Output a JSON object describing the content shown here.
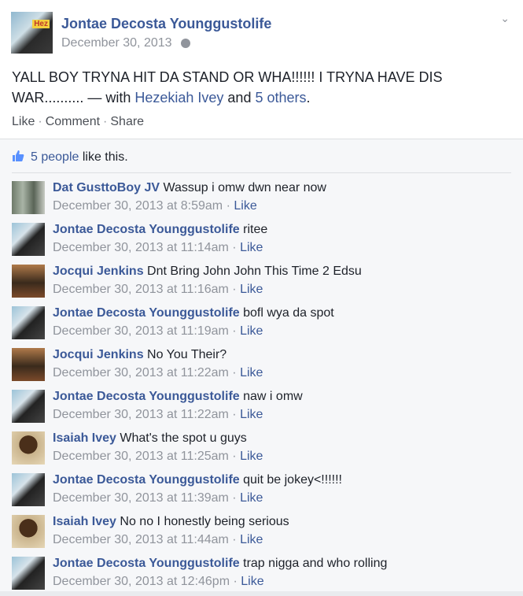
{
  "post": {
    "author": "Jontae Decosta Younggustolife",
    "date": "December 30, 2013",
    "text_part1": "YALL BOY TRYNA HIT DA STAND OR WHA!!!!!! I TRYNA HAVE DIS WAR.......... — with ",
    "tag1": "Hezekiah Ivey",
    "and": " and ",
    "tag2": "5 others",
    "text_end": ".",
    "avatar_badge": "Hez"
  },
  "actions": {
    "like": "Like",
    "comment": "Comment",
    "share": "Share",
    "sep": "·"
  },
  "likes": {
    "count": "5 people",
    "suffix": " like this."
  },
  "comments": [
    {
      "name": "Dat GusttoBoy JV",
      "text": "Wassup i omw dwn near now",
      "time": "December 30, 2013 at 8:59am",
      "like": "Like"
    },
    {
      "name": "Jontae Decosta Younggustolife",
      "text": "ritee",
      "time": "December 30, 2013 at 11:14am",
      "like": "Like"
    },
    {
      "name": "Jocqui Jenkins",
      "text": "Dnt Bring John John This Time 2 Edsu",
      "time": "December 30, 2013 at 11:16am",
      "like": "Like"
    },
    {
      "name": "Jontae Decosta Younggustolife",
      "text": "bofl wya da spot",
      "time": "December 30, 2013 at 11:19am",
      "like": "Like"
    },
    {
      "name": "Jocqui Jenkins",
      "text": "No You Their?",
      "time": "December 30, 2013 at 11:22am",
      "like": "Like"
    },
    {
      "name": "Jontae Decosta Younggustolife",
      "text": "naw i omw",
      "time": "December 30, 2013 at 11:22am",
      "like": "Like"
    },
    {
      "name": "Isaiah Ivey",
      "text": "What's the spot u guys",
      "time": "December 30, 2013 at 11:25am",
      "like": "Like"
    },
    {
      "name": "Jontae Decosta Younggustolife",
      "text": "quit be jokey<!!!!!!",
      "time": "December 30, 2013 at 11:39am",
      "like": "Like"
    },
    {
      "name": "Isaiah Ivey",
      "text": "No no I honestly being serious",
      "time": "December 30, 2013 at 11:44am",
      "like": "Like"
    },
    {
      "name": "Jontae Decosta Younggustolife",
      "text": "trap nigga and who rolling",
      "time": "December 30, 2013 at 12:46pm",
      "like": "Like"
    }
  ],
  "colors": {
    "link": "#3b5998",
    "meta": "#90949c",
    "text": "#1d2129"
  }
}
